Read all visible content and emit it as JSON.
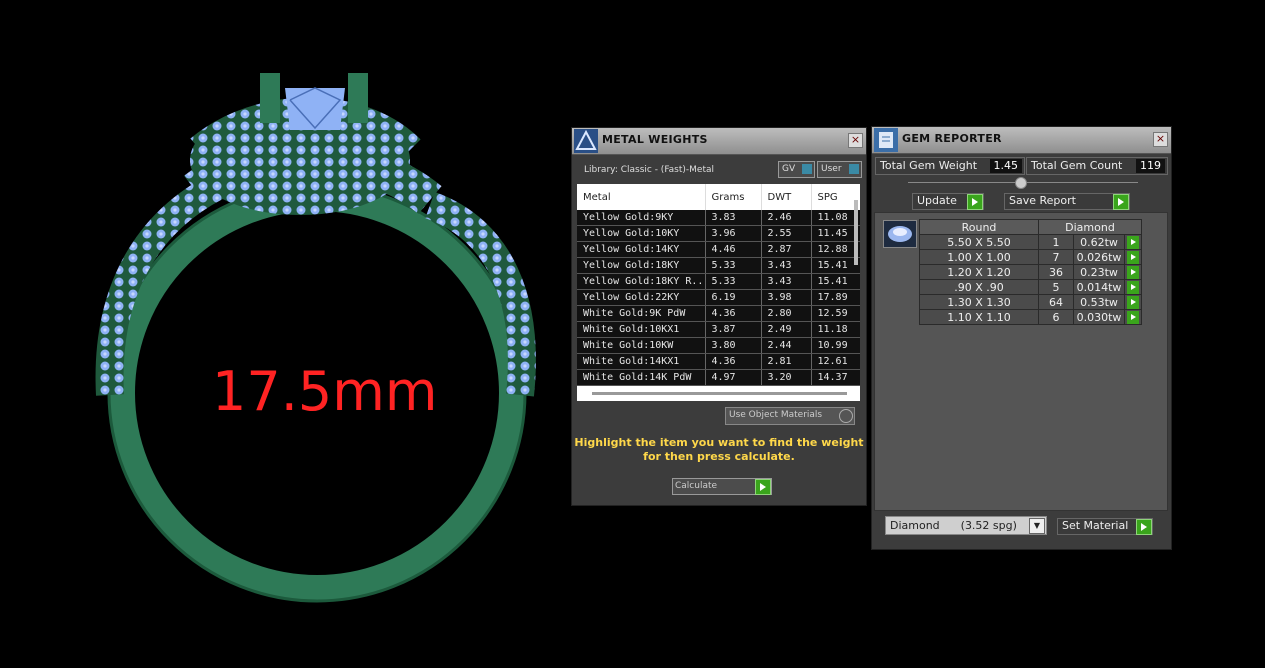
{
  "viewport": {
    "measurement": "17.5mm",
    "colors": {
      "metal": "#2e7a57",
      "metal_dark": "#1c5a3c",
      "gems": "#8fb2f5",
      "measure": "#ff2323"
    }
  },
  "metal_weights": {
    "title": "METAL WEIGHTS",
    "library": "Library: Classic - (Fast)-Metal",
    "toggle_gv": "GV",
    "toggle_user": "User",
    "columns": [
      "Metal",
      "Grams",
      "DWT",
      "SPG"
    ],
    "rows": [
      [
        "Yellow Gold:9KY",
        "3.83",
        "2.46",
        "11.08"
      ],
      [
        "Yellow Gold:10KY",
        "3.96",
        "2.55",
        "11.45"
      ],
      [
        "Yellow Gold:14KY",
        "4.46",
        "2.87",
        "12.88"
      ],
      [
        "Yellow Gold:18KY",
        "5.33",
        "3.43",
        "15.41"
      ],
      [
        "Yellow Gold:18KY R...",
        "5.33",
        "3.43",
        "15.41"
      ],
      [
        "Yellow Gold:22KY",
        "6.19",
        "3.98",
        "17.89"
      ],
      [
        "White Gold:9K PdW",
        "4.36",
        "2.80",
        "12.59"
      ],
      [
        "White Gold:10KX1",
        "3.87",
        "2.49",
        "11.18"
      ],
      [
        "White Gold:10KW",
        "3.80",
        "2.44",
        "10.99"
      ],
      [
        "White Gold:14KX1",
        "4.36",
        "2.81",
        "12.61"
      ],
      [
        "White Gold:14K PdW",
        "4.97",
        "3.20",
        "14.37"
      ]
    ],
    "use_object_materials": "Use Object Materials",
    "hint_line1": "Highlight the item you want to find the weight",
    "hint_line2": "for then press calculate.",
    "calculate": "Calculate"
  },
  "gem_reporter": {
    "title": "GEM REPORTER",
    "total_weight_label": "Total Gem Weight",
    "total_weight": "1.45",
    "total_count_label": "Total Gem Count",
    "total_count": "119",
    "update": "Update",
    "save_report": "Save Report",
    "cut": "Round",
    "material": "Diamond",
    "gems": [
      [
        "5.50 X 5.50",
        "1",
        "0.62tw"
      ],
      [
        "1.00 X 1.00",
        "7",
        "0.026tw"
      ],
      [
        "1.20 X 1.20",
        "36",
        "0.23tw"
      ],
      [
        ".90 X .90",
        "5",
        "0.014tw"
      ],
      [
        "1.30 X 1.30",
        "64",
        "0.53tw"
      ],
      [
        "1.10 X 1.10",
        "6",
        "0.030tw"
      ]
    ],
    "material_select": "Diamond      (3.52 spg)",
    "set_material": "Set Material"
  }
}
